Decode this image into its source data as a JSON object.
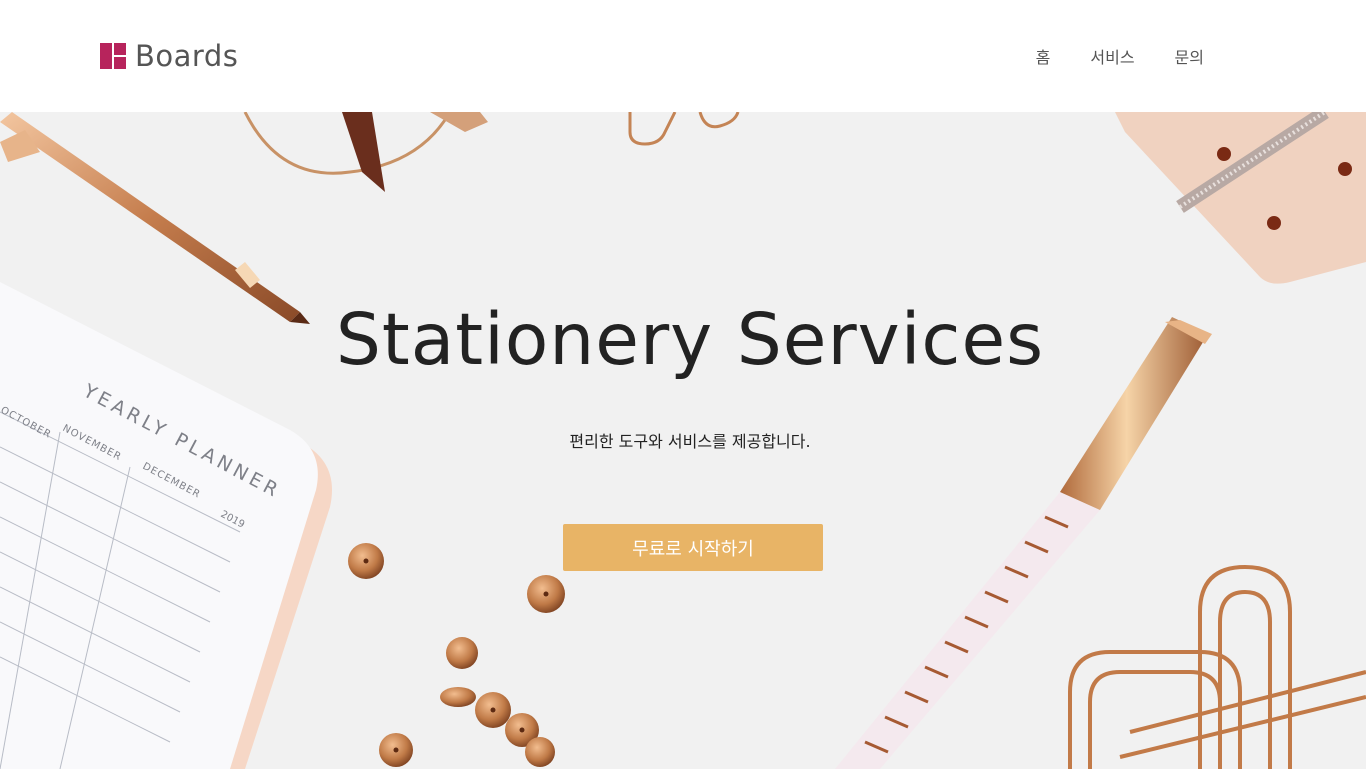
{
  "brand": {
    "name": "Boards",
    "logo_color": "#b7245c"
  },
  "nav": {
    "items": [
      "홈",
      "서비스",
      "문의"
    ]
  },
  "hero": {
    "title": "Stationery Services",
    "subtitle": "편리한 도구와 서비스를 제공합니다.",
    "cta_label": "무료로 시작하기",
    "cta_color": "#e8b466"
  },
  "planner": {
    "title": "YEARLY PLANNER",
    "year": "2019",
    "months": [
      "OCTOBER",
      "NOVEMBER",
      "DECEMBER"
    ]
  }
}
